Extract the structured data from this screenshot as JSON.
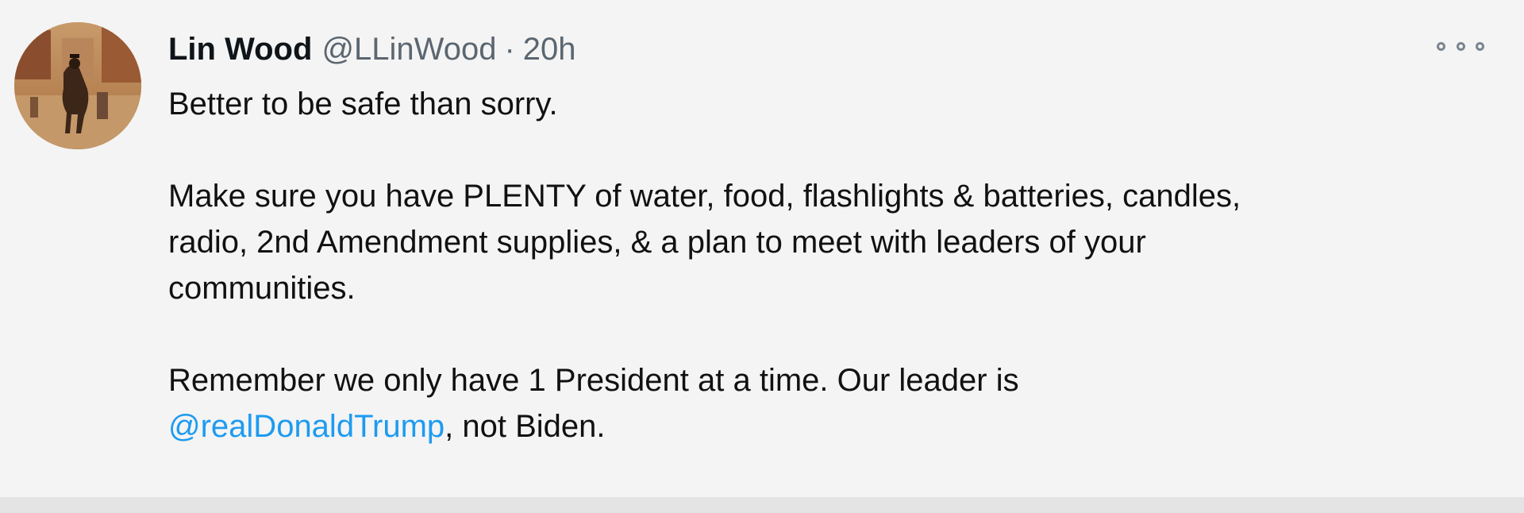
{
  "tweet": {
    "author_name": "Lin Wood",
    "author_handle": "@LLinWood",
    "separator": "·",
    "timestamp": "20h",
    "more_icon": "ellipsis-icon",
    "text": {
      "line1": "Better to be safe than sorry.",
      "para2_line1": "Make sure you have PLENTY of water, food, flashlights & batteries, candles,",
      "para2_line2": "radio, 2nd Amendment supplies, & a plan to meet with leaders of your",
      "para2_line3": "communities.",
      "para3_line1": "Remember we only have 1 President at a time. Our leader is",
      "mention": "@realDonaldTrump",
      "para3_tail": ", not Biden."
    }
  },
  "colors": {
    "link": "#1d9bf0",
    "secondary_text": "#5b6670",
    "background": "#f4f4f4"
  }
}
